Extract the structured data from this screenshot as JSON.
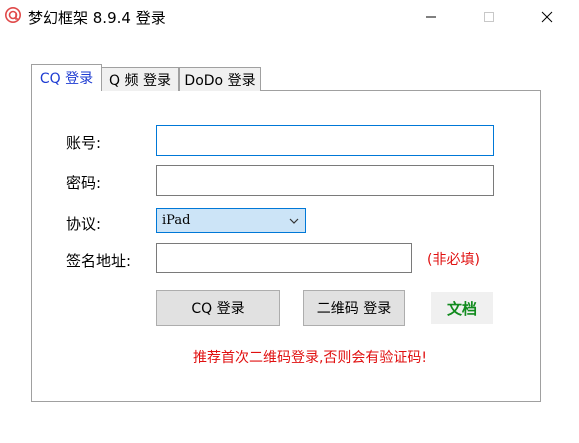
{
  "window": {
    "title": "梦幻框架 8.9.4 登录"
  },
  "tabs": [
    {
      "label": "CQ 登录",
      "active": true
    },
    {
      "label": "Q 频 登录",
      "active": false
    },
    {
      "label": "DoDo 登录",
      "active": false
    }
  ],
  "form": {
    "account_label": "账号:",
    "account_value": "",
    "password_label": "密码:",
    "password_value": "",
    "protocol_label": "协议:",
    "protocol_selected": "iPad",
    "sign_label": "签名地址:",
    "sign_value": "",
    "sign_hint": "(非必填)"
  },
  "actions": {
    "cq_login": "CQ 登录",
    "qr_login": "二维码 登录",
    "docs": "文档"
  },
  "warning": "推荐首次二维码登录,否则会有验证码!",
  "colors": {
    "accent": "#0078d7",
    "active_tab_text": "#1e3cd2",
    "warning": "#e01010",
    "docs": "#118b1e"
  },
  "icons": {
    "app": "app-logo-icon",
    "minimize": "minimize-icon",
    "maximize": "maximize-icon",
    "close": "close-icon",
    "dropdown": "chevron-down-icon"
  }
}
